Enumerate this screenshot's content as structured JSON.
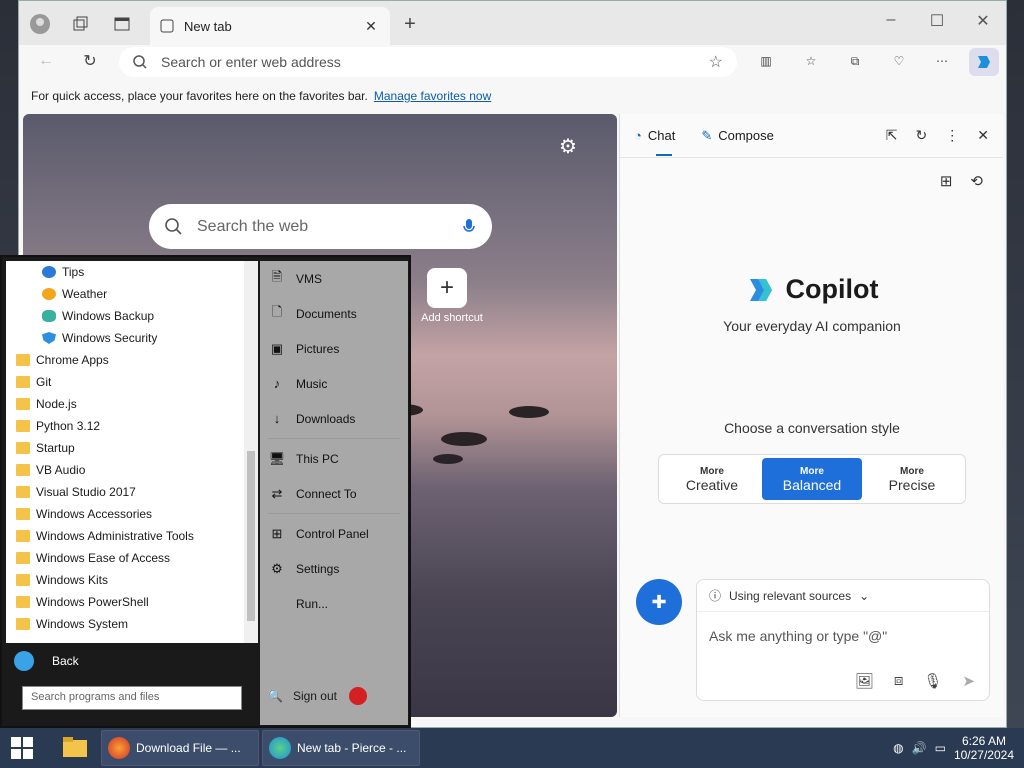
{
  "browser": {
    "tab_title": "New tab",
    "address_placeholder": "Search or enter web address",
    "favbar_text": "For quick access, place your favorites here on the favorites bar.",
    "favbar_link": "Manage favorites now"
  },
  "newtab": {
    "search_placeholder": "Search the web",
    "add_shortcut": "Add shortcut"
  },
  "copilot": {
    "tabs": [
      "Chat",
      "Compose"
    ],
    "title": "Copilot",
    "subtitle": "Your everyday AI companion",
    "style_label": "Choose a conversation style",
    "styles": [
      {
        "more": "More",
        "name": "Creative"
      },
      {
        "more": "More",
        "name": "Balanced"
      },
      {
        "more": "More",
        "name": "Precise"
      }
    ],
    "sources": "Using relevant sources",
    "ask_placeholder": "Ask me anything or type \"@\""
  },
  "start": {
    "programs": [
      {
        "label": "Tips",
        "type": "app"
      },
      {
        "label": "Weather",
        "type": "app"
      },
      {
        "label": "Windows Backup",
        "type": "app"
      },
      {
        "label": "Windows Security",
        "type": "app"
      },
      {
        "label": "Chrome Apps",
        "type": "folder"
      },
      {
        "label": "Git",
        "type": "folder"
      },
      {
        "label": "Node.js",
        "type": "folder"
      },
      {
        "label": "Python 3.12",
        "type": "folder"
      },
      {
        "label": "Startup",
        "type": "folder"
      },
      {
        "label": "VB Audio",
        "type": "folder"
      },
      {
        "label": "Visual Studio 2017",
        "type": "folder"
      },
      {
        "label": "Windows Accessories",
        "type": "folder"
      },
      {
        "label": "Windows Administrative Tools",
        "type": "folder"
      },
      {
        "label": "Windows Ease of Access",
        "type": "folder"
      },
      {
        "label": "Windows Kits",
        "type": "folder"
      },
      {
        "label": "Windows PowerShell",
        "type": "folder"
      },
      {
        "label": "Windows System",
        "type": "folder"
      }
    ],
    "back": "Back",
    "search_placeholder": "Search programs and files",
    "right_items": [
      "VMS",
      "Documents",
      "Pictures",
      "Music",
      "Downloads",
      "This PC",
      "Connect To",
      "Control Panel",
      "Settings",
      "Run..."
    ],
    "sign_out": "Sign out"
  },
  "taskbar": {
    "items": [
      "Download File — ...",
      "New tab - Pierce - ..."
    ],
    "time": "6:26 AM",
    "date": "10/27/2024"
  }
}
